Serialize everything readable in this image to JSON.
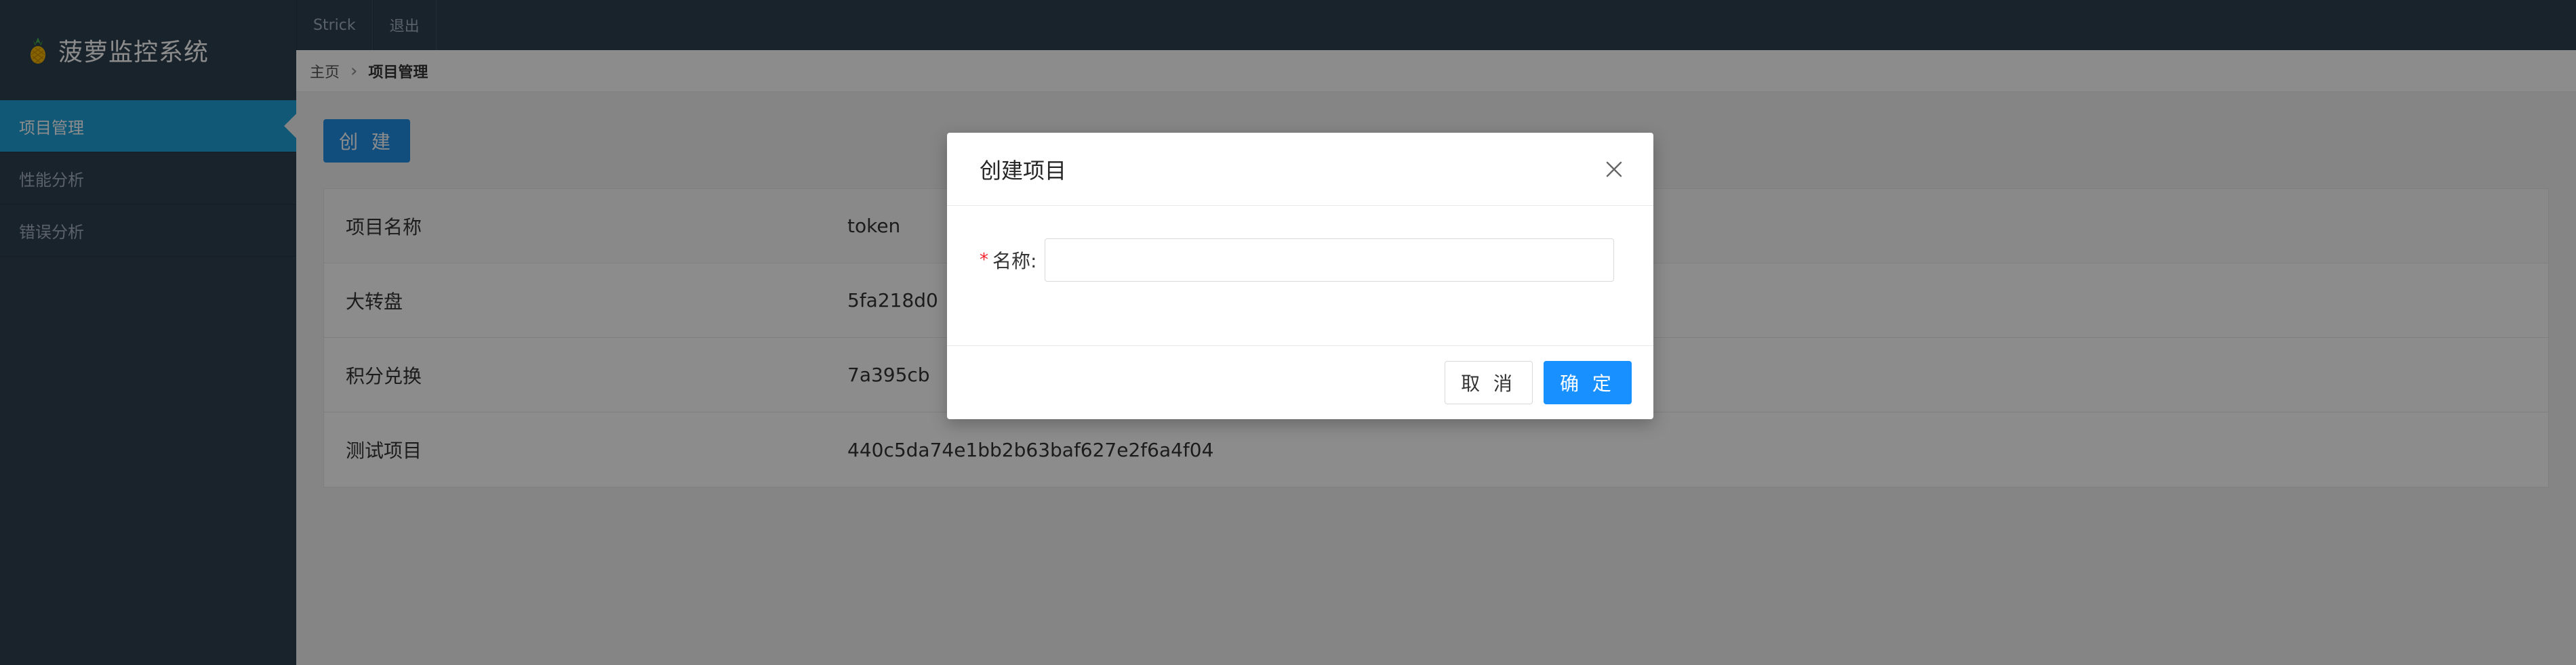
{
  "app": {
    "title": "菠萝监控系统"
  },
  "sidebar": {
    "items": [
      {
        "label": "项目管理",
        "active": true
      },
      {
        "label": "性能分析",
        "active": false
      },
      {
        "label": "错误分析",
        "active": false
      }
    ]
  },
  "topbar": {
    "user": "Strick",
    "logout": "退出"
  },
  "breadcrumb": {
    "home": "主页",
    "current": "项目管理"
  },
  "toolbar": {
    "create_label": "创 建"
  },
  "table": {
    "headers": [
      "项目名称",
      "token"
    ],
    "rows": [
      {
        "name": "大转盘",
        "token": "5fa218d0"
      },
      {
        "name": "积分兑换",
        "token": "7a395cb"
      },
      {
        "name": "测试项目",
        "token": "440c5da74e1bb2b63baf627e2f6a4f04"
      }
    ]
  },
  "modal": {
    "title": "创建项目",
    "name_label": "名称:",
    "name_value": "",
    "cancel_label": "取 消",
    "ok_label": "确 定"
  },
  "colors": {
    "sidebar_bg": "#2f4050",
    "active_item": "#1f9fd8",
    "primary": "#1890ff"
  }
}
